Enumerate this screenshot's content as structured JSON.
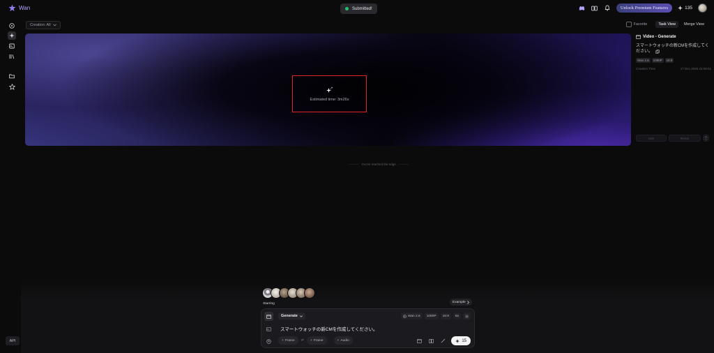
{
  "app": {
    "name": "Wan"
  },
  "toast": {
    "text": "Submitted!"
  },
  "topbar": {
    "premium_label": "Unlock Premium Features",
    "credits": "135"
  },
  "sidebar": {
    "api_label": "API"
  },
  "filter": {
    "label": "Creation: All"
  },
  "view": {
    "favorite_label": "Favorite",
    "task_view": "Task View",
    "merge_view": "Merge View"
  },
  "preview": {
    "estimated_text": "Estimated time: 3m26s"
  },
  "feed": {
    "edge_text": "You've reached the edge"
  },
  "detail": {
    "title": "Video - Generate",
    "prompt": "スマートウォッチの新CMを作成してください。",
    "tags": [
      "Wan 2.6",
      "1080P",
      "16:9"
    ],
    "creation_label": "Creation Time",
    "creation_value": "17 Dec 2025 22:09:51",
    "use_label": "Use",
    "rerun_label": "Rerun"
  },
  "composer": {
    "starring_label": "Starring",
    "example_label": "Example",
    "mode_label": "Generate",
    "model_label": "Wan 2.6",
    "resolution": "1080P",
    "aspect": "16:9",
    "duration": "5s",
    "prompt": "スマートウォッチの新CMを作成してください。",
    "frame1_label": "Frame",
    "frame2_label": "Frame",
    "audio_label": "Audio",
    "cost": "15"
  },
  "colors": {
    "accent": "#b9a6ff",
    "highlight_box": "#e0262b",
    "success": "#21c46b"
  }
}
